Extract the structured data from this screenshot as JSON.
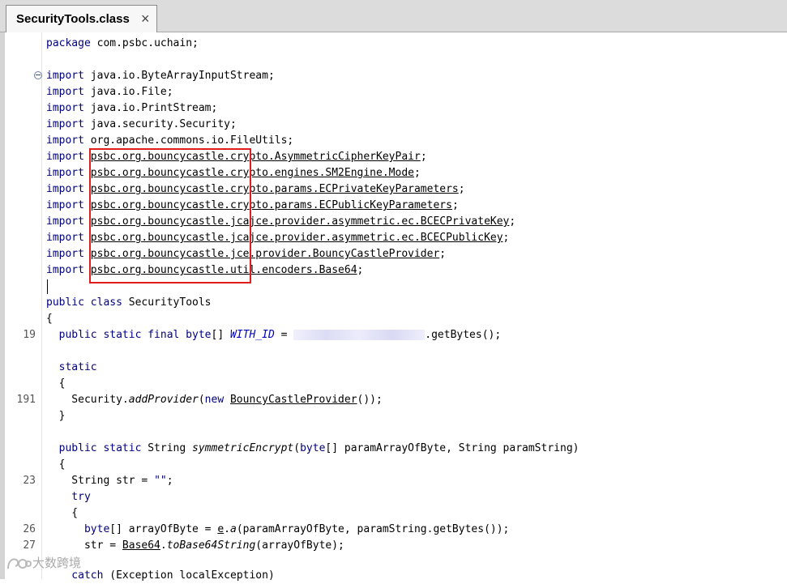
{
  "tab": {
    "title": "SecurityTools.class",
    "close": "×"
  },
  "lines": {
    "l0": {
      "kw": "package",
      "rest": " com.psbc.uchain;"
    },
    "l2": {
      "kw": "import",
      "rest": " java.io.ByteArrayInputStream;"
    },
    "l3": {
      "kw": "import",
      "rest": " java.io.File;"
    },
    "l4": {
      "kw": "import",
      "rest": " java.io.PrintStream;"
    },
    "l5": {
      "kw": "import",
      "rest": " java.security.Security;"
    },
    "l6": {
      "kw": "import",
      "rest": " org.apache.commons.io.FileUtils;"
    },
    "l7": {
      "kw": "import",
      "sp": " ",
      "pkg": "psbc.org.bouncycastle",
      "rest": ".crypto.AsymmetricCipherKeyPair",
      "end": ";"
    },
    "l8": {
      "kw": "import",
      "sp": " ",
      "pkg": "psbc.org.bouncycastle",
      "rest": ".crypto.engines.SM2Engine.Mode",
      "end": ";"
    },
    "l9": {
      "kw": "import",
      "sp": " ",
      "pkg": "psbc.org.bouncycastle",
      "rest": ".crypto.params.ECPrivateKeyParameters",
      "end": ";"
    },
    "l10": {
      "kw": "import",
      "sp": " ",
      "pkg": "psbc.org.bouncycastle",
      "rest": ".crypto.params.ECPublicKeyParameters",
      "end": ";"
    },
    "l11": {
      "kw": "import",
      "sp": " ",
      "pkg": "psbc.org.bouncycastle",
      "rest": ".jcajce.provider.asymmetric.ec.BCECPrivateKey",
      "end": ";"
    },
    "l12": {
      "kw": "import",
      "sp": " ",
      "pkg": "psbc.org.bouncycastle",
      "rest": ".jcajce.provider.asymmetric.ec.BCECPublicKey",
      "end": ";"
    },
    "l13": {
      "kw": "import",
      "sp": " ",
      "pkg": "psbc.org.bouncycastle",
      "rest": ".jce.provider.BouncyCastleProvider",
      "end": ";"
    },
    "l14": {
      "kw": "import",
      "sp": " ",
      "pkg": "psbc.org.bouncycastle",
      "rest": ".util.encoders.Base64",
      "end": ";"
    },
    "l16": {
      "kw": "public class",
      "rest": " SecurityTools"
    },
    "l17": {
      "text": "{"
    },
    "l18": {
      "kw": "  public static final byte",
      "a": "[] ",
      "field": "WITH_ID",
      "b": " = ",
      "c": ".getBytes();"
    },
    "l20": {
      "kw": "  static"
    },
    "l21": {
      "text": "  {"
    },
    "l22": {
      "a": "    Security.",
      "m": "addProvider",
      "b": "(",
      "kw": "new",
      "sp": " ",
      "u": "BouncyCastleProvider",
      "c": "());"
    },
    "l23": {
      "text": "  }"
    },
    "l25": {
      "kw": "  public static",
      "a": " String ",
      "m": "symmetricEncrypt",
      "b": "(",
      "kw2": "byte",
      "c": "[] paramArrayOfByte, String paramString)"
    },
    "l26": {
      "text": "  {"
    },
    "l27": {
      "a": "    String str = ",
      "s": "\"\"",
      "b": ";"
    },
    "l28": {
      "kw": "    try"
    },
    "l29": {
      "text": "    {"
    },
    "l30": {
      "kw": "      byte",
      "a": "[] arrayOfByte = ",
      "u": "e",
      "b": ".",
      "m": "a",
      "c": "(paramArrayOfByte, paramString.getBytes());"
    },
    "l31": {
      "a": "      str = ",
      "u": "Base64",
      "b": ".",
      "m": "toBase64String",
      "c": "(arrayOfByte);"
    },
    "l33": {
      "kw": "    catch",
      "a": " (Exception localException)"
    }
  },
  "line_numbers": {
    "n18": "19",
    "n22": "191",
    "n27": "23",
    "n30": "26",
    "n31": "27"
  },
  "watermark": "大数跨境"
}
